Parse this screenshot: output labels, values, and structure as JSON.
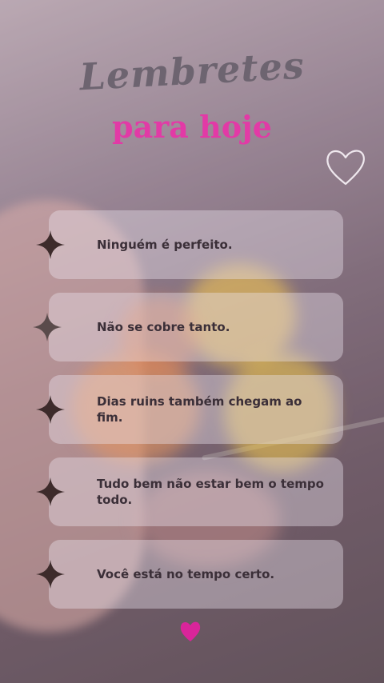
{
  "header": {
    "title_script": "Lembretes",
    "title_sub": "para hoje"
  },
  "colors": {
    "accent_pink": "#e23aa6",
    "script_gray": "#6d6470",
    "text_dark": "#3b2f38",
    "sparkle": "#3d2b2b"
  },
  "icons": {
    "top_right": "heart-outline-icon",
    "bottom": "heart-filled-icon",
    "bullet": "four-point-sparkle-icon"
  },
  "reminders": [
    {
      "text": "Ninguém é perfeito."
    },
    {
      "text": "Não se cobre tanto."
    },
    {
      "text": "Dias ruins também chegam ao fim."
    },
    {
      "text": "Tudo bem não estar bem o tempo todo."
    },
    {
      "text": "Você está no tempo certo."
    }
  ]
}
